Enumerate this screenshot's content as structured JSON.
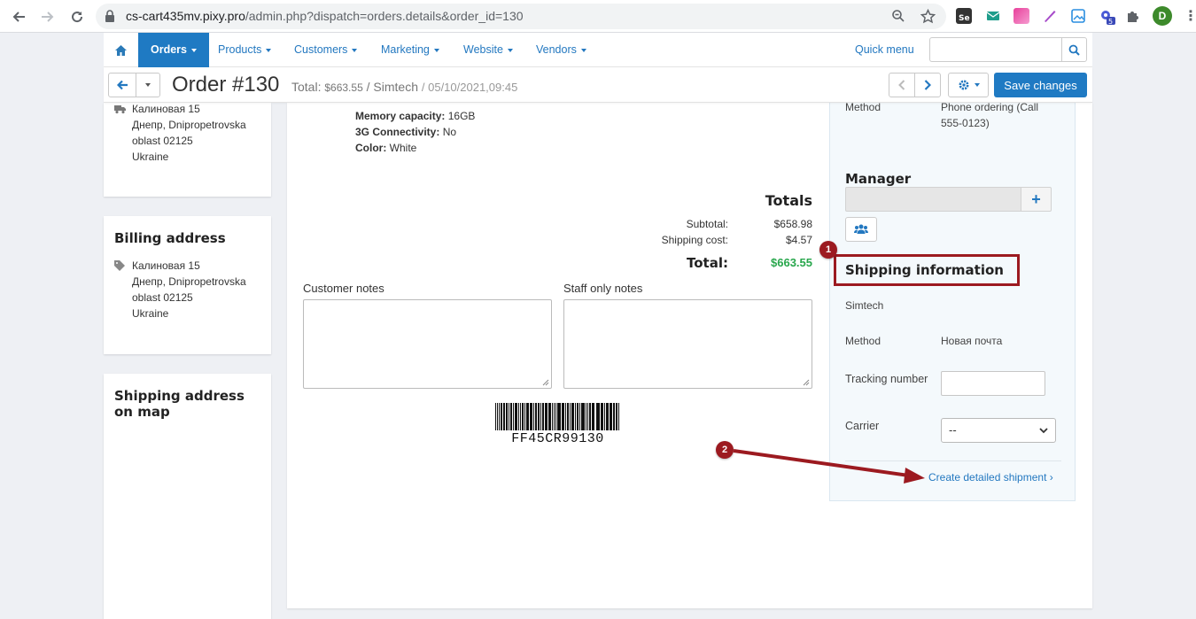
{
  "browser": {
    "url_host": "cs-cart435mv.pixy.pro",
    "url_path": "/admin.php?dispatch=orders.details&order_id=130",
    "profile_initial": "D",
    "extension_badge": "5"
  },
  "nav": {
    "items": [
      {
        "label": "Orders",
        "active": true
      },
      {
        "label": "Products"
      },
      {
        "label": "Customers"
      },
      {
        "label": "Marketing"
      },
      {
        "label": "Website"
      },
      {
        "label": "Vendors"
      }
    ],
    "quick_menu": "Quick menu",
    "search_placeholder": ""
  },
  "title_bar": {
    "order_title": "Order #130",
    "total_label": "Total:",
    "total_amount": "$663.55",
    "separator": "/",
    "vendor": "Simtech",
    "date": "/ 05/10/2021,09:45",
    "save_label": "Save changes"
  },
  "shipping_address_card": {
    "lines": [
      "Калиновая 15",
      "Днепр, Dnipropetrovska",
      "oblast 02125",
      "Ukraine"
    ]
  },
  "billing_address_card": {
    "title": "Billing address",
    "lines": [
      "Калиновая 15",
      "Днепр, Dnipropetrovska",
      "oblast 02125",
      "Ukraine"
    ]
  },
  "map_card": {
    "title_line1": "Shipping address",
    "title_line2": "on map"
  },
  "product": {
    "attrs": [
      {
        "name": "Memory capacity:",
        "value": "16GB"
      },
      {
        "name": "3G Connectivity:",
        "value": "No"
      },
      {
        "name": "Color:",
        "value": "White"
      }
    ]
  },
  "totals": {
    "title": "Totals",
    "subtotal_label": "Subtotal:",
    "subtotal_value": "$658.98",
    "shipping_label": "Shipping cost:",
    "shipping_value": "$4.57",
    "grand_label": "Total:",
    "grand_value": "$663.55"
  },
  "notes": {
    "customer_label": "Customer notes",
    "staff_label": "Staff only notes"
  },
  "barcode": {
    "code": "FF45CR99130"
  },
  "side": {
    "payment_method_label": "Method",
    "payment_method_value_1": "Phone ordering (Call",
    "payment_method_value_2": "555-0123)",
    "manager_title": "Manager",
    "shipping_title": "Shipping information",
    "shipping_vendor": "Simtech",
    "shipping_method_label": "Method",
    "shipping_method_value": "Новая почта",
    "tracking_label": "Tracking number",
    "carrier_label": "Carrier",
    "carrier_value": "--",
    "shipment_link": "Create detailed shipment ›"
  },
  "callouts": [
    "1",
    "2"
  ],
  "colors": {
    "accent": "#1f7ac3",
    "link": "#2378c0",
    "total_green": "#29a74d",
    "annotation_red": "#9c1a20"
  }
}
